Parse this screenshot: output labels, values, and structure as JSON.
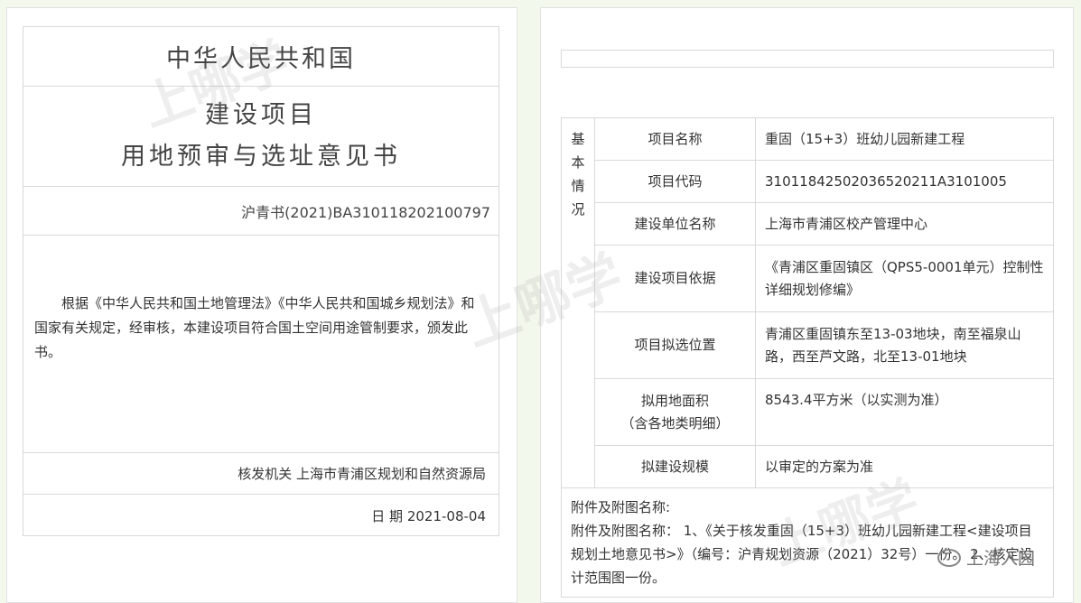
{
  "certificate": {
    "country": "中华人民共和国",
    "title_line1": "建设项目",
    "title_line2": "用地预审与选址意见书",
    "doc_number": "沪青书(2021)BA310118202100797",
    "body": "根据《中华人民共和国土地管理法》《中华人民共和国城乡规划法》和国家有关规定，经审核，本建设项目符合国土空间用途管制要求，颁发此书。",
    "issuer": "核发机关 上海市青浦区规划和自然资源局",
    "date": "日  期 2021-08-04"
  },
  "form": {
    "section_label": "基本情况",
    "rows": [
      {
        "label": "项目名称",
        "value": "重固（15+3）班幼儿园新建工程"
      },
      {
        "label": "项目代码",
        "value": "31011842502036520211A3101005"
      },
      {
        "label": "建设单位名称",
        "value": "上海市青浦区校产管理中心"
      },
      {
        "label": "建设项目依据",
        "value": "《青浦区重固镇区（QPS5-0001单元）控制性详细规划修编》"
      },
      {
        "label": "项目拟选位置",
        "value": "青浦区重固镇东至13-03地块，南至福泉山路，西至芦文路，北至13-01地块"
      },
      {
        "label": "拟用地面积",
        "label2": "（含各地类明细）",
        "value": "8543.4平方米（以实测为准）"
      },
      {
        "label": "拟建设规模",
        "value": "以审定的方案为准"
      }
    ],
    "attachments_title": "附件及附图名称:",
    "attachments_text": "附件及附图名称： 1、《关于核发重固（15+3）班幼儿园新建工程<建设项目规划土地意见书>》（编号：沪青规划资源（2021）32号）一份。 2、核定设计范围图一份。"
  },
  "watermark": {
    "brand": "上哪学",
    "source": "上海入园"
  }
}
